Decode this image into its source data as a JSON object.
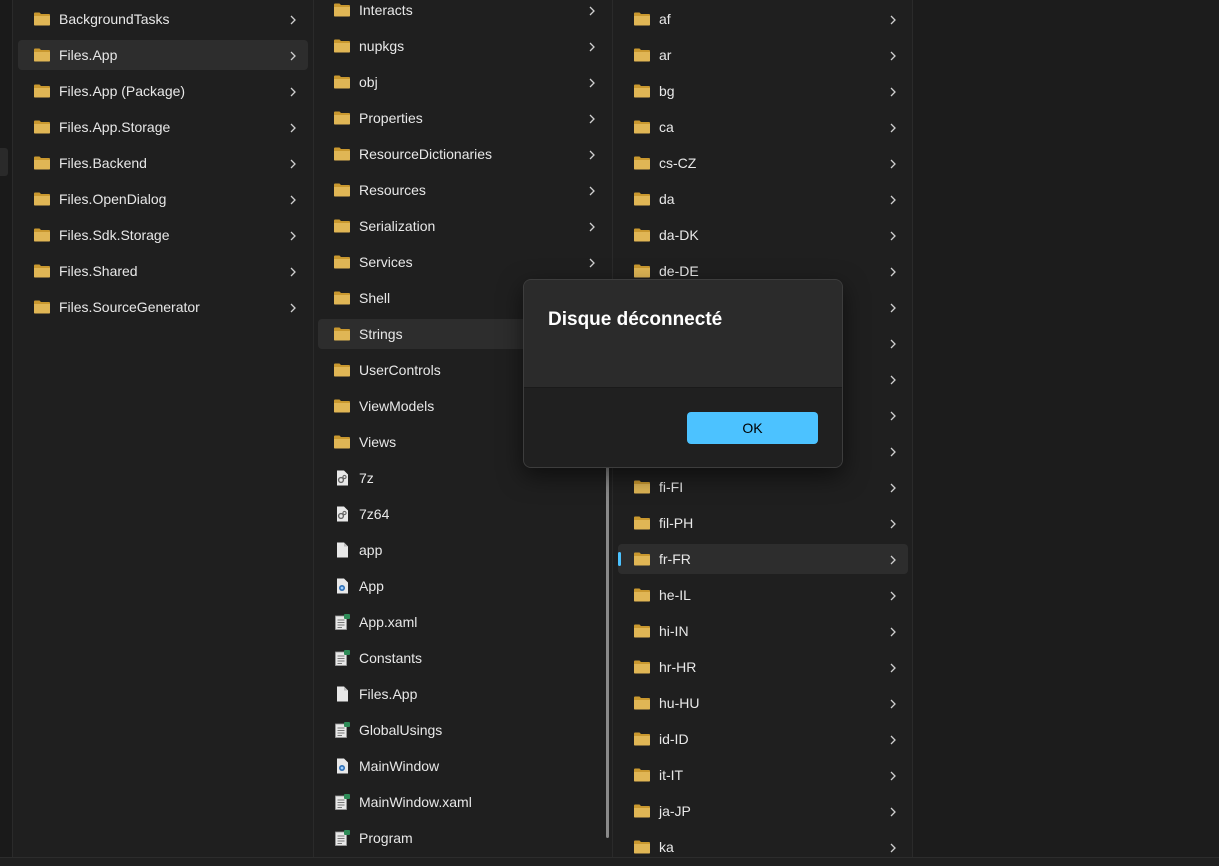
{
  "columns": [
    {
      "items": [
        {
          "label": "BackgroundTasks",
          "icon": "folder-icon",
          "chevron": true
        },
        {
          "label": "Files.App",
          "icon": "folder-icon",
          "chevron": true,
          "selected": true
        },
        {
          "label": "Files.App (Package)",
          "icon": "folder-icon",
          "chevron": true
        },
        {
          "label": "Files.App.Storage",
          "icon": "folder-icon",
          "chevron": true
        },
        {
          "label": "Files.Backend",
          "icon": "folder-icon",
          "chevron": true
        },
        {
          "label": "Files.OpenDialog",
          "icon": "folder-icon",
          "chevron": true
        },
        {
          "label": "Files.Sdk.Storage",
          "icon": "folder-icon",
          "chevron": true
        },
        {
          "label": "Files.Shared",
          "icon": "folder-icon",
          "chevron": true
        },
        {
          "label": "Files.SourceGenerator",
          "icon": "folder-icon",
          "chevron": true
        }
      ]
    },
    {
      "items": [
        {
          "label": "Interacts",
          "icon": "folder-icon",
          "chevron": true
        },
        {
          "label": "nupkgs",
          "icon": "folder-icon",
          "chevron": true
        },
        {
          "label": "obj",
          "icon": "folder-icon",
          "chevron": true
        },
        {
          "label": "Properties",
          "icon": "folder-icon",
          "chevron": true
        },
        {
          "label": "ResourceDictionaries",
          "icon": "folder-icon",
          "chevron": true
        },
        {
          "label": "Resources",
          "icon": "folder-icon",
          "chevron": true
        },
        {
          "label": "Serialization",
          "icon": "folder-icon",
          "chevron": true
        },
        {
          "label": "Services",
          "icon": "folder-icon",
          "chevron": true
        },
        {
          "label": "Shell",
          "icon": "folder-icon",
          "chevron": true
        },
        {
          "label": "Strings",
          "icon": "folder-icon",
          "chevron": true,
          "selected": true
        },
        {
          "label": "UserControls",
          "icon": "folder-icon",
          "chevron": true
        },
        {
          "label": "ViewModels",
          "icon": "folder-icon",
          "chevron": true
        },
        {
          "label": "Views",
          "icon": "folder-icon",
          "chevron": true
        },
        {
          "label": "7z",
          "icon": "dll-file-icon",
          "chevron": false
        },
        {
          "label": "7z64",
          "icon": "dll-file-icon",
          "chevron": false
        },
        {
          "label": "app",
          "icon": "file-icon",
          "chevron": false
        },
        {
          "label": "App",
          "icon": "xaml-file-icon",
          "chevron": false
        },
        {
          "label": "App.xaml",
          "icon": "cs-file-icon",
          "chevron": false
        },
        {
          "label": "Constants",
          "icon": "cs-file-icon",
          "chevron": false
        },
        {
          "label": "Files.App",
          "icon": "file-icon",
          "chevron": false
        },
        {
          "label": "GlobalUsings",
          "icon": "cs-file-icon",
          "chevron": false
        },
        {
          "label": "MainWindow",
          "icon": "xaml-file-icon",
          "chevron": false
        },
        {
          "label": "MainWindow.xaml",
          "icon": "cs-file-icon",
          "chevron": false
        },
        {
          "label": "Program",
          "icon": "cs-file-icon",
          "chevron": false
        }
      ]
    },
    {
      "items": [
        {
          "label": "af",
          "icon": "folder-icon",
          "chevron": true
        },
        {
          "label": "ar",
          "icon": "folder-icon",
          "chevron": true
        },
        {
          "label": "bg",
          "icon": "folder-icon",
          "chevron": true
        },
        {
          "label": "ca",
          "icon": "folder-icon",
          "chevron": true
        },
        {
          "label": "cs-CZ",
          "icon": "folder-icon",
          "chevron": true
        },
        {
          "label": "da",
          "icon": "folder-icon",
          "chevron": true
        },
        {
          "label": "da-DK",
          "icon": "folder-icon",
          "chevron": true
        },
        {
          "label": "de-DE",
          "icon": "folder-icon",
          "chevron": true
        },
        {
          "label": "",
          "icon": "folder-icon",
          "chevron": true
        },
        {
          "label": "",
          "icon": "folder-icon",
          "chevron": true
        },
        {
          "label": "",
          "icon": "folder-icon",
          "chevron": true
        },
        {
          "label": "",
          "icon": "folder-icon",
          "chevron": true
        },
        {
          "label": "",
          "icon": "folder-icon",
          "chevron": true
        },
        {
          "label": "fi-FI",
          "icon": "folder-icon",
          "chevron": true
        },
        {
          "label": "fil-PH",
          "icon": "folder-icon",
          "chevron": true
        },
        {
          "label": "fr-FR",
          "icon": "folder-icon",
          "chevron": true,
          "selected": true,
          "accent": true
        },
        {
          "label": "he-IL",
          "icon": "folder-icon",
          "chevron": true
        },
        {
          "label": "hi-IN",
          "icon": "folder-icon",
          "chevron": true
        },
        {
          "label": "hr-HR",
          "icon": "folder-icon",
          "chevron": true
        },
        {
          "label": "hu-HU",
          "icon": "folder-icon",
          "chevron": true
        },
        {
          "label": "id-ID",
          "icon": "folder-icon",
          "chevron": true
        },
        {
          "label": "it-IT",
          "icon": "folder-icon",
          "chevron": true
        },
        {
          "label": "ja-JP",
          "icon": "folder-icon",
          "chevron": true
        },
        {
          "label": "ka",
          "icon": "folder-icon",
          "chevron": true
        }
      ]
    }
  ],
  "dialog": {
    "title": "Disque déconnecté",
    "ok_label": "OK"
  },
  "colors": {
    "accent": "#4cc2ff",
    "folder": "#dcb04c",
    "background": "#1f1f1f",
    "selected": "#2d2d2d"
  }
}
